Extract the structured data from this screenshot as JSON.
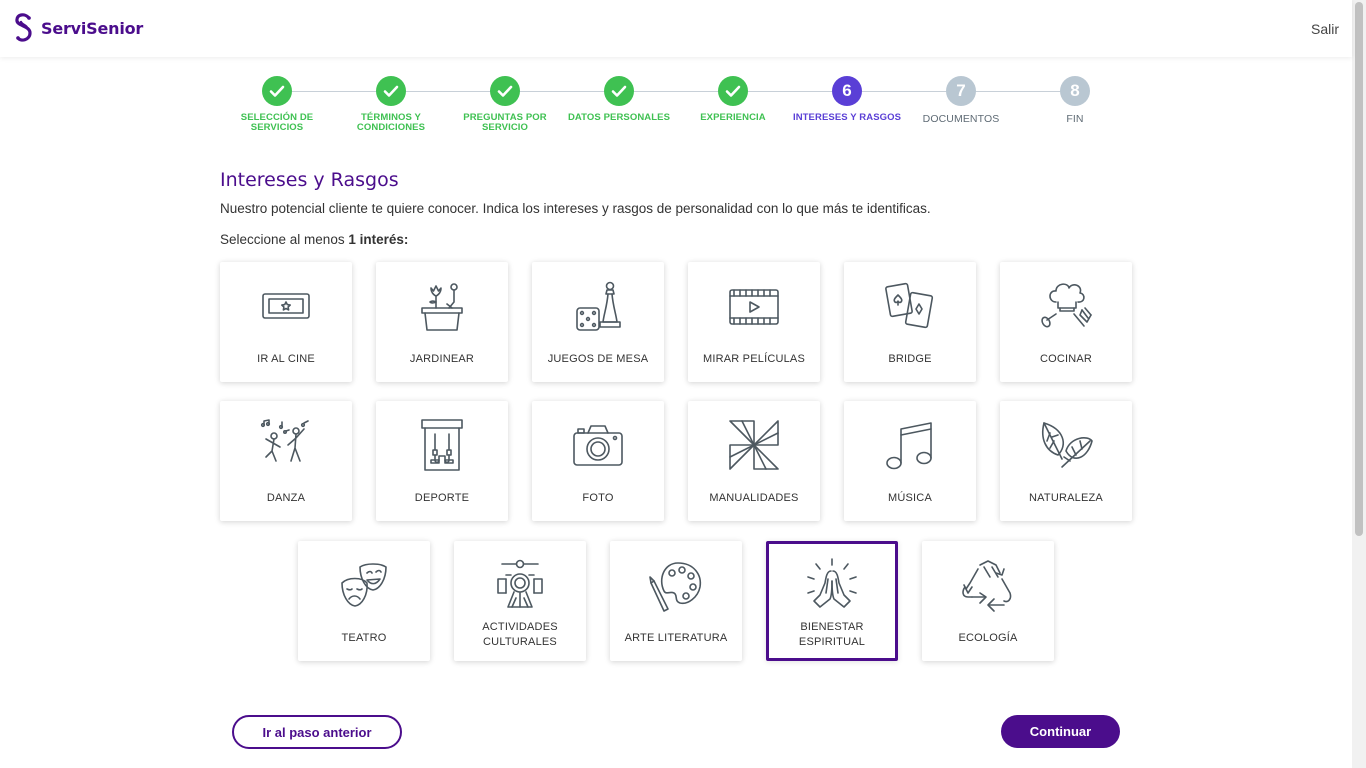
{
  "header": {
    "brand": "ServiSenior",
    "logout_label": "Salir",
    "brand_color": "#4b0d8c"
  },
  "stepper": {
    "steps": [
      {
        "number": "1",
        "label": "SELECCIÓN DE SERVICIOS",
        "status": "done"
      },
      {
        "number": "2",
        "label": "TÉRMINOS Y CONDICIONES",
        "status": "done"
      },
      {
        "number": "3",
        "label": "PREGUNTAS POR SERVICIO",
        "status": "done"
      },
      {
        "number": "4",
        "label": "DATOS PERSONALES",
        "status": "done"
      },
      {
        "number": "5",
        "label": "EXPERIENCIA",
        "status": "done"
      },
      {
        "number": "6",
        "label": "INTERESES Y RASGOS",
        "status": "active"
      },
      {
        "number": "7",
        "label": "DOCUMENTOS",
        "status": "todo"
      },
      {
        "number": "8",
        "label": "FIN",
        "status": "todo"
      }
    ],
    "colors": {
      "done": "#3fc152",
      "active": "#5a3fd6",
      "todo": "#b9c7d2"
    }
  },
  "page": {
    "title": "Intereses y Rasgos",
    "subtitle": "Nuestro potencial cliente te quiere conocer. Indica los intereses y rasgos de personalidad con lo que más te identificas.",
    "instruction_prefix": "Seleccione al menos ",
    "instruction_bold": "1 interés:"
  },
  "interests": [
    {
      "label": "IR AL CINE",
      "icon": "ticket-icon",
      "selected": false
    },
    {
      "label": "JARDINEAR",
      "icon": "garden-icon",
      "selected": false
    },
    {
      "label": "JUEGOS DE MESA",
      "icon": "board-game-icon",
      "selected": false
    },
    {
      "label": "MIRAR PELÍCULAS",
      "icon": "film-icon",
      "selected": false
    },
    {
      "label": "BRIDGE",
      "icon": "cards-icon",
      "selected": false
    },
    {
      "label": "COCINAR",
      "icon": "chef-icon",
      "selected": false
    },
    {
      "label": "DANZA",
      "icon": "dance-icon",
      "selected": false
    },
    {
      "label": "DEPORTE",
      "icon": "sport-icon",
      "selected": false
    },
    {
      "label": "FOTO",
      "icon": "camera-icon",
      "selected": false
    },
    {
      "label": "MANUALIDADES",
      "icon": "pinwheel-icon",
      "selected": false
    },
    {
      "label": "MÚSICA",
      "icon": "music-note-icon",
      "selected": false
    },
    {
      "label": "NATURALEZA",
      "icon": "leaf-icon",
      "selected": false
    },
    {
      "label": "TEATRO",
      "icon": "theater-masks-icon",
      "selected": false
    },
    {
      "label": "ACTIVIDADES CULTURALES",
      "icon": "culture-icon",
      "selected": false
    },
    {
      "label": "ARTE LITERATURA",
      "icon": "palette-icon",
      "selected": false
    },
    {
      "label": "BIENESTAR ESPIRITUAL",
      "icon": "praying-hands-icon",
      "selected": true
    },
    {
      "label": "ECOLOGÍA",
      "icon": "recycle-icon",
      "selected": false
    }
  ],
  "actions": {
    "back_label": "Ir al paso anterior",
    "next_label": "Continuar"
  }
}
